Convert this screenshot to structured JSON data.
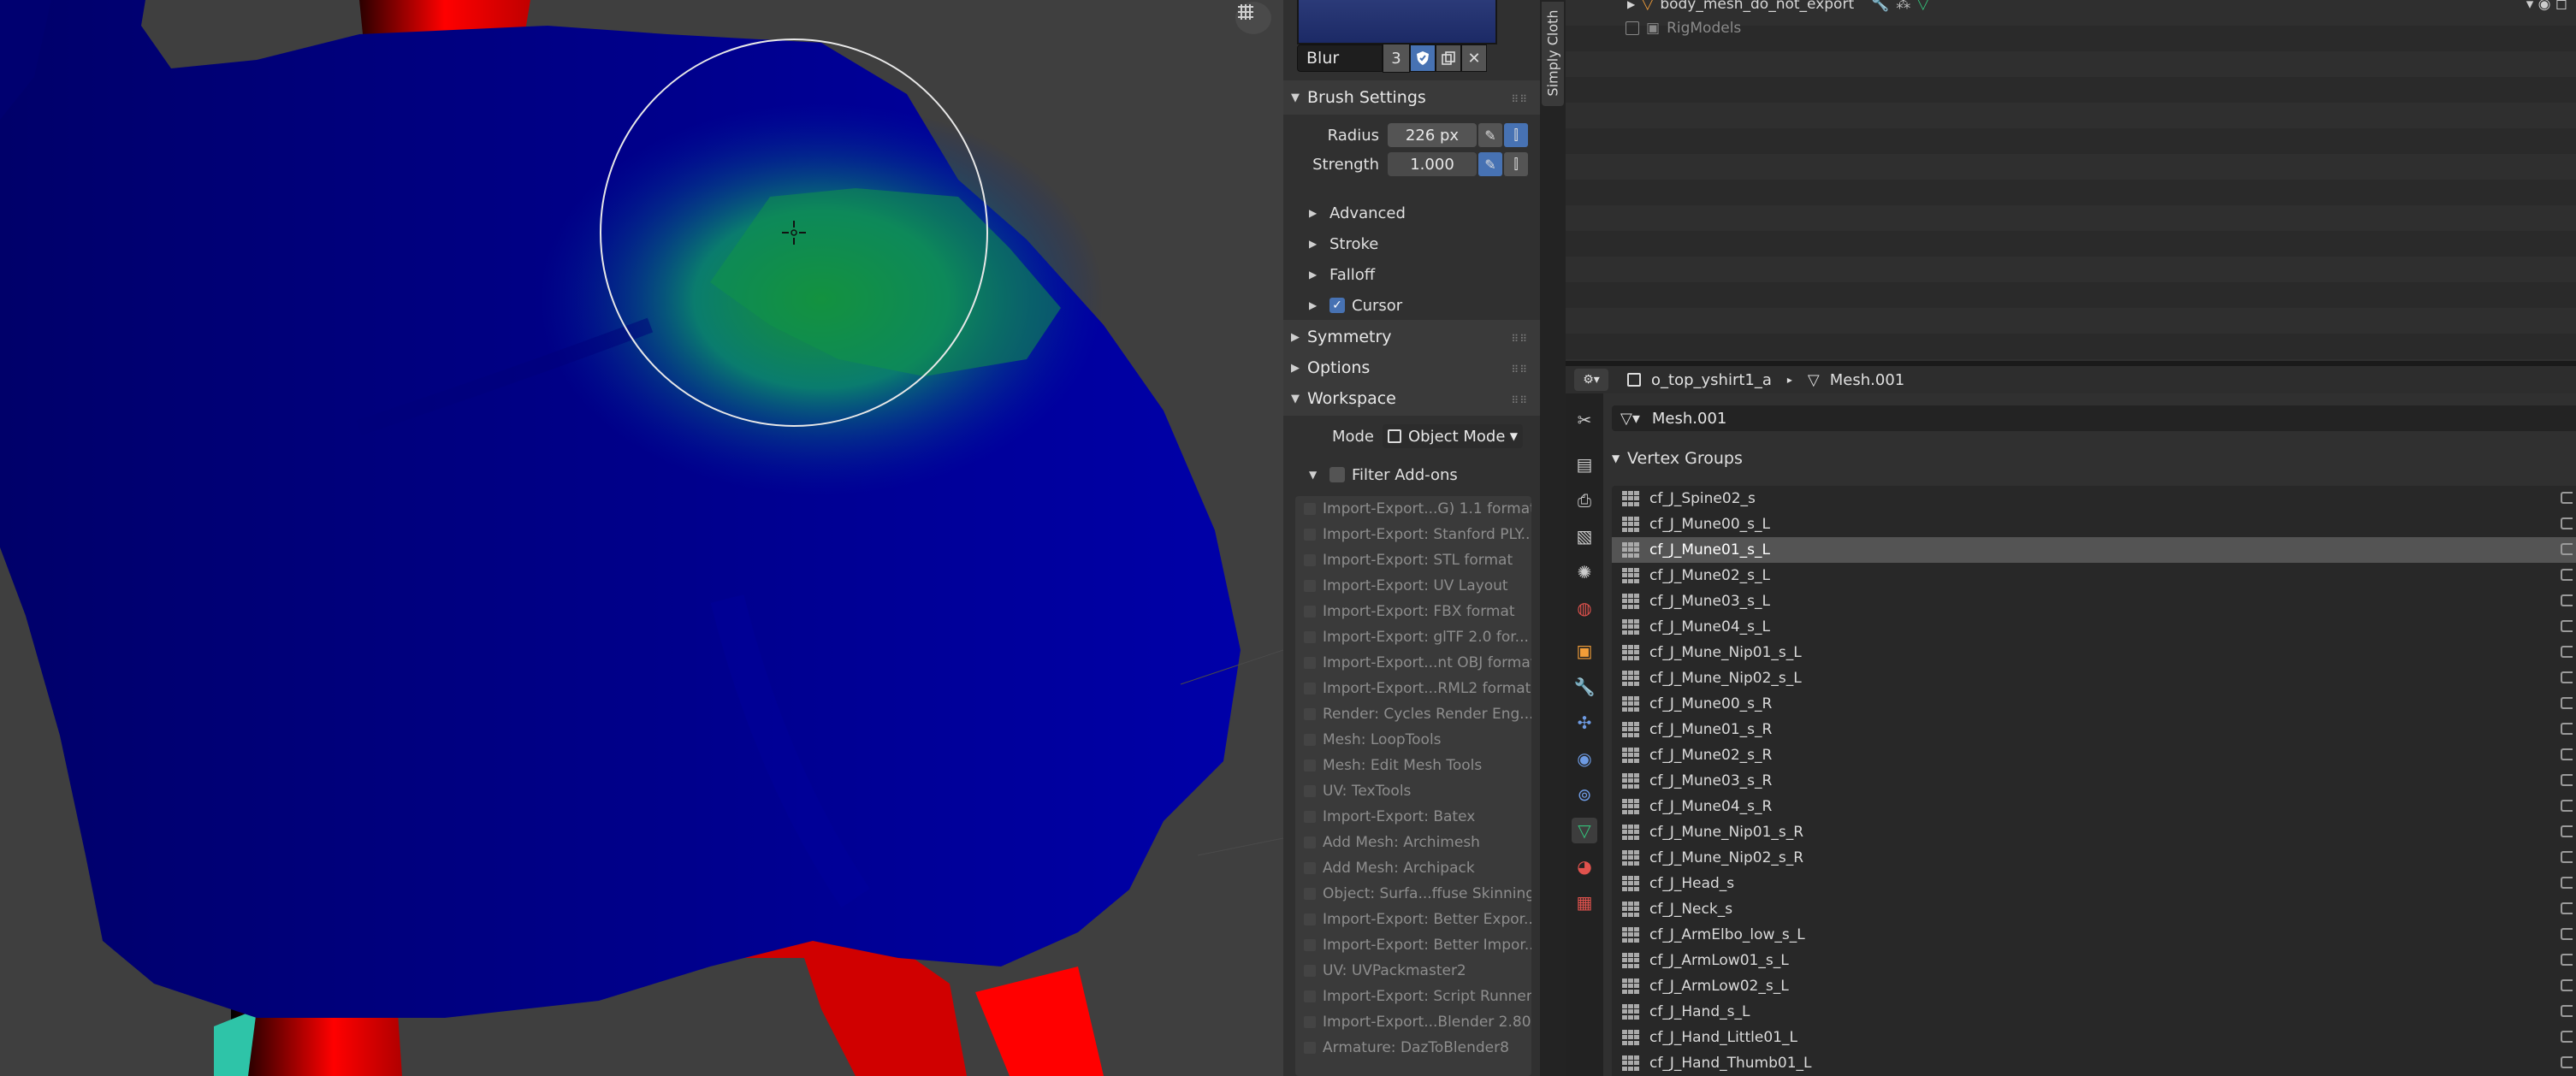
{
  "brush": {
    "name": "Blur",
    "users": "3"
  },
  "panels": {
    "brush_settings": "Brush Settings",
    "radius_label": "Radius",
    "radius_value": "226 px",
    "strength_label": "Strength",
    "strength_value": "1.000",
    "advanced": "Advanced",
    "stroke": "Stroke",
    "falloff": "Falloff",
    "cursor": "Cursor",
    "symmetry": "Symmetry",
    "options": "Options",
    "workspace": "Workspace",
    "mode_label": "Mode",
    "mode_value": "Object Mode",
    "filter_addons": "Filter Add-ons"
  },
  "addons": [
    "Import-Export...G) 1.1 format",
    "Import-Export: Stanford PLY...",
    "Import-Export: STL format",
    "Import-Export: UV Layout",
    "Import-Export: FBX format",
    "Import-Export: glTF 2.0 for...",
    "Import-Export...nt OBJ format",
    "Import-Export...RML2 format",
    "Render: Cycles Render Eng...",
    "Mesh: LoopTools",
    "Mesh: Edit Mesh Tools",
    "UV: TexTools",
    "Import-Export: Batex",
    "Add Mesh: Archimesh",
    "Add Mesh: Archipack",
    "Object: Surfa...ffuse Skinning",
    "Import-Export: Better Expor...",
    "Import-Export: Better Impor...",
    "UV: UVPackmaster2",
    "Import-Export: Script Runner",
    "Import-Export...Blender 2.80)",
    "Armature: DazToBlender8"
  ],
  "vertical_tab": "Simply Cloth",
  "outliner": {
    "items": [
      "body_mesh_do_not_export",
      "RigModels"
    ]
  },
  "properties": {
    "object_name": "o_top_yshirt1_a",
    "mesh_name": "Mesh.001",
    "datablock_name": "Mesh.001",
    "vertex_groups_title": "Vertex Groups",
    "selected_group": "cf_J_Mune01_s_L",
    "vertex_groups": [
      "cf_J_Spine02_s",
      "cf_J_Mune00_s_L",
      "cf_J_Mune01_s_L",
      "cf_J_Mune02_s_L",
      "cf_J_Mune03_s_L",
      "cf_J_Mune04_s_L",
      "cf_J_Mune_Nip01_s_L",
      "cf_J_Mune_Nip02_s_L",
      "cf_J_Mune00_s_R",
      "cf_J_Mune01_s_R",
      "cf_J_Mune02_s_R",
      "cf_J_Mune03_s_R",
      "cf_J_Mune04_s_R",
      "cf_J_Mune_Nip01_s_R",
      "cf_J_Mune_Nip02_s_R",
      "cf_J_Head_s",
      "cf_J_Neck_s",
      "cf_J_ArmElbo_low_s_L",
      "cf_J_ArmLow01_s_L",
      "cf_J_ArmLow02_s_L",
      "cf_J_Hand_s_L",
      "cf_J_Hand_Little01_L",
      "cf_J_Hand_Thumb01_L"
    ]
  },
  "colors": {
    "accent": "#4772b3",
    "mesh_blue": "#00008f",
    "mesh_red": "#e00000",
    "mesh_green": "#1a9a3a"
  }
}
